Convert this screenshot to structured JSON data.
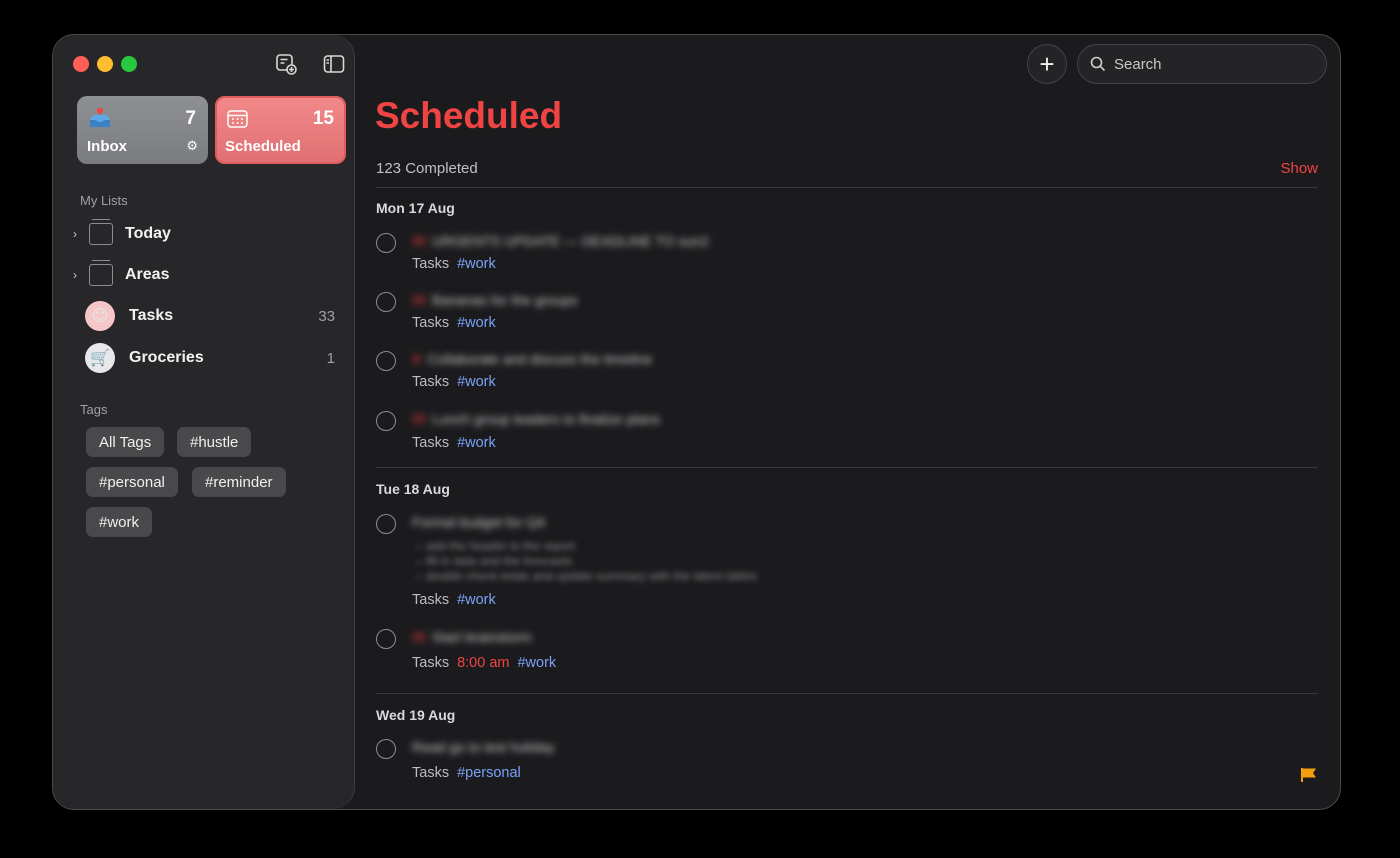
{
  "window": {
    "title": "Scheduled"
  },
  "toolbar": {
    "search_placeholder": "Search"
  },
  "smart_lists": [
    {
      "label": "Inbox",
      "count": "7"
    },
    {
      "label": "Scheduled",
      "count": "15"
    }
  ],
  "sidebar": {
    "my_lists_label": "My Lists",
    "lists": [
      {
        "label": "Today",
        "count": "",
        "icon": "folder-icon"
      },
      {
        "label": "Areas",
        "count": "",
        "icon": "folder-icon"
      },
      {
        "label": "Tasks",
        "count": "33",
        "icon": "smile-emoji-icon"
      },
      {
        "label": "Groceries",
        "count": "1",
        "icon": "cart-icon"
      }
    ],
    "tags_label": "Tags",
    "tags": [
      "All Tags",
      "#hustle",
      "#personal",
      "#reminder",
      "#work"
    ]
  },
  "main": {
    "title": "Scheduled",
    "completed_text": "123 Completed",
    "show_label": "Show",
    "days": [
      {
        "header": "Mon 17 Aug",
        "tasks": [
          {
            "priority": "!!!",
            "title": "URGENTS UPDATE — DEADLINE TO sun2",
            "list": "Tasks",
            "tag": "#work"
          },
          {
            "priority": "!!!",
            "title": "Bananas for the groups",
            "list": "Tasks",
            "tag": "#work"
          },
          {
            "priority": "!!",
            "title": "Collaborate and discuss the timeline",
            "list": "Tasks",
            "tag": "#work"
          },
          {
            "priority": "!!!",
            "title": "Lunch group leaders to finalize plans",
            "list": "Tasks",
            "tag": "#work"
          }
        ]
      },
      {
        "header": "Tue 18 Aug",
        "tasks": [
          {
            "priority": "",
            "title": "Formal budget for Q4",
            "notes": [
              "– add the header to the report",
              "– fill in data and the forecasts",
              "– double-check totals and update summary with the latest tables"
            ],
            "list": "Tasks",
            "tag": "#work"
          },
          {
            "priority": "!!!",
            "title": "Start brainstorm",
            "list": "Tasks",
            "time": "8:00 am",
            "tag": "#work"
          }
        ]
      },
      {
        "header": "Wed 19 Aug",
        "tasks": [
          {
            "priority": "",
            "title": "Read go to lest holiday",
            "list": "Tasks",
            "tag": "#personal",
            "flagged": true
          }
        ]
      }
    ]
  },
  "colors": {
    "accent_red": "#ef4444",
    "tag_blue": "#7aa2f7",
    "flag_orange": "#f59e0b"
  }
}
